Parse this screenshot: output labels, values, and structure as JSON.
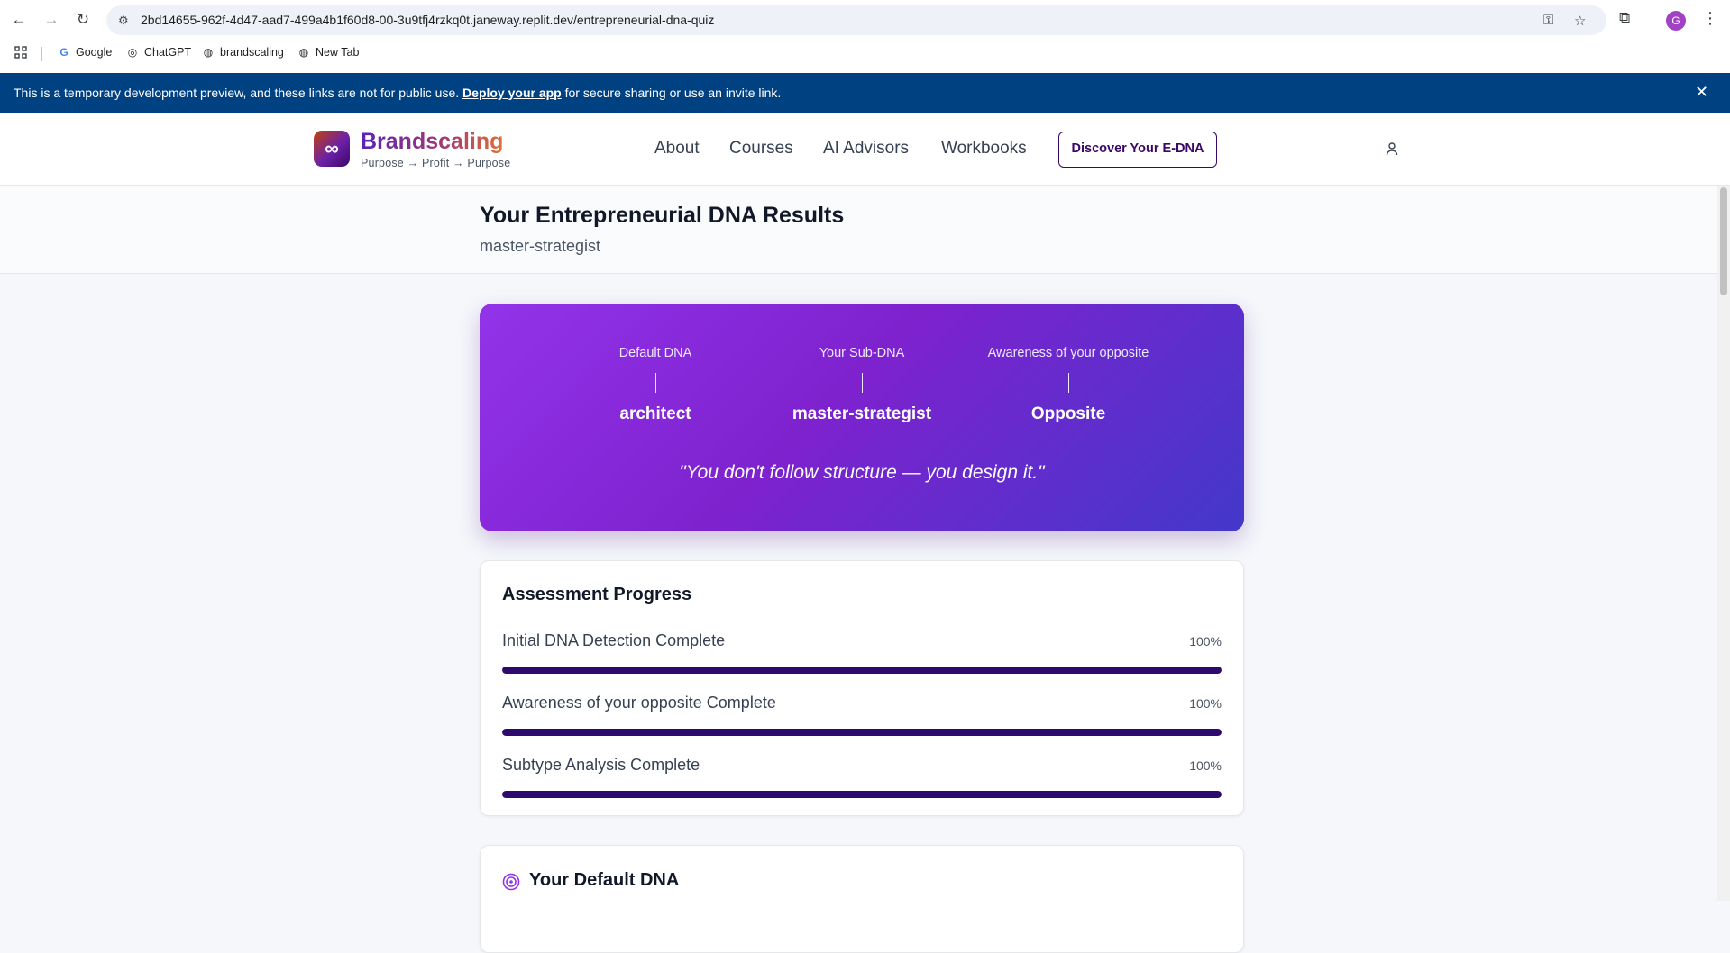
{
  "browser": {
    "url": "2bd14655-962f-4d47-aad7-499a4b1f60d8-00-3u9tfj4rzkq0t.janeway.replit.dev/entrepreneurial-dna-quiz",
    "avatar_letter": "G",
    "bookmarks": [
      {
        "label": "Google",
        "icon": "google-icon"
      },
      {
        "label": "ChatGPT",
        "icon": "chatgpt-icon"
      },
      {
        "label": "brandscaling",
        "icon": "globe-icon"
      },
      {
        "label": "New Tab",
        "icon": "globe-icon"
      }
    ]
  },
  "dev_banner": {
    "text_before": "This is a temporary development preview, and these links are not for public use.",
    "link": "Deploy your app",
    "text_after": "for secure sharing or use an invite link."
  },
  "header": {
    "brand_name": "Brandscaling",
    "brand_tagline": "Purpose → Profit → Purpose",
    "logo_glyph": "∞",
    "nav": [
      "About",
      "Courses",
      "AI Advisors",
      "Workbooks"
    ],
    "cta": "Discover Your E-DNA"
  },
  "page": {
    "title": "Your Entrepreneurial DNA Results",
    "subtitle": "master-strategist"
  },
  "hero": {
    "columns": [
      {
        "label": "Default DNA",
        "value": "architect"
      },
      {
        "label": "Your Sub-DNA",
        "value": "master-strategist"
      },
      {
        "label": "Awareness of your opposite",
        "value": "Opposite"
      }
    ],
    "quote": "\"You don't follow structure — you design it.\"",
    "colors": {
      "start": "#9333ea",
      "end": "#4338ca"
    }
  },
  "progress": {
    "title": "Assessment Progress",
    "items": [
      {
        "label": "Initial DNA Detection Complete",
        "percent_label": "100%",
        "value": 100
      },
      {
        "label": "Awareness of your opposite Complete",
        "percent_label": "100%",
        "value": 100
      },
      {
        "label": "Subtype Analysis Complete",
        "percent_label": "100%",
        "value": 100
      }
    ],
    "bar_color": "#2e0a6e"
  },
  "default_dna": {
    "title": "Your Default DNA",
    "icon": "target-icon"
  }
}
